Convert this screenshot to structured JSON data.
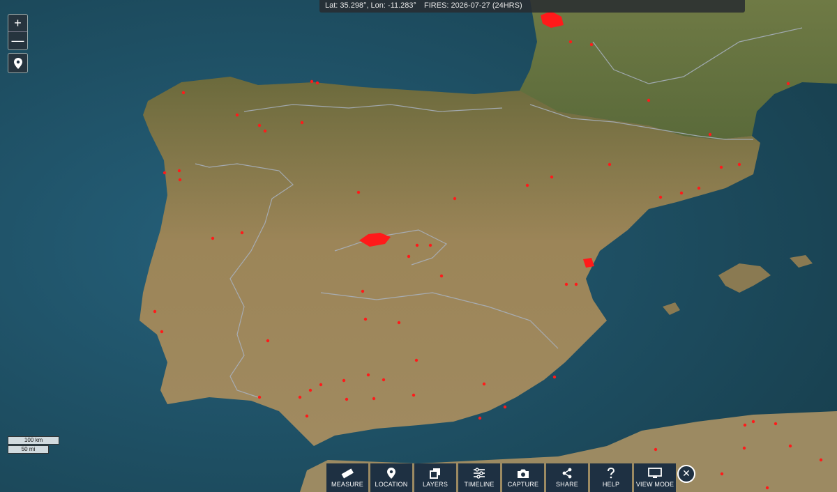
{
  "map": {
    "land_color": "#8a7a52",
    "sea_color": "#1d4a5e",
    "fire_color": "#ff1a1a",
    "border_color": "#a9b3c2"
  },
  "status_bar": {
    "coords": "Lat: 35.298°, Lon: -11.283°",
    "fires": "FIRES: 2026-07-27 (24HRS)"
  },
  "zoom": {
    "in": "+",
    "out": "—"
  },
  "scale": {
    "km": "100 km",
    "mi": "50 mi"
  },
  "toolbar": [
    {
      "label": "MEASURE",
      "icon": "ruler-icon"
    },
    {
      "label": "LOCATION",
      "icon": "pin-icon"
    },
    {
      "label": "LAYERS",
      "icon": "layers-icon"
    },
    {
      "label": "TIMELINE",
      "icon": "sliders-icon"
    },
    {
      "label": "CAPTURE",
      "icon": "camera-icon"
    },
    {
      "label": "SHARE",
      "icon": "share-icon"
    },
    {
      "label": "HELP",
      "icon": "help-icon"
    },
    {
      "label": "VIEW MODE",
      "icon": "monitor-icon"
    }
  ],
  "close": "✕"
}
